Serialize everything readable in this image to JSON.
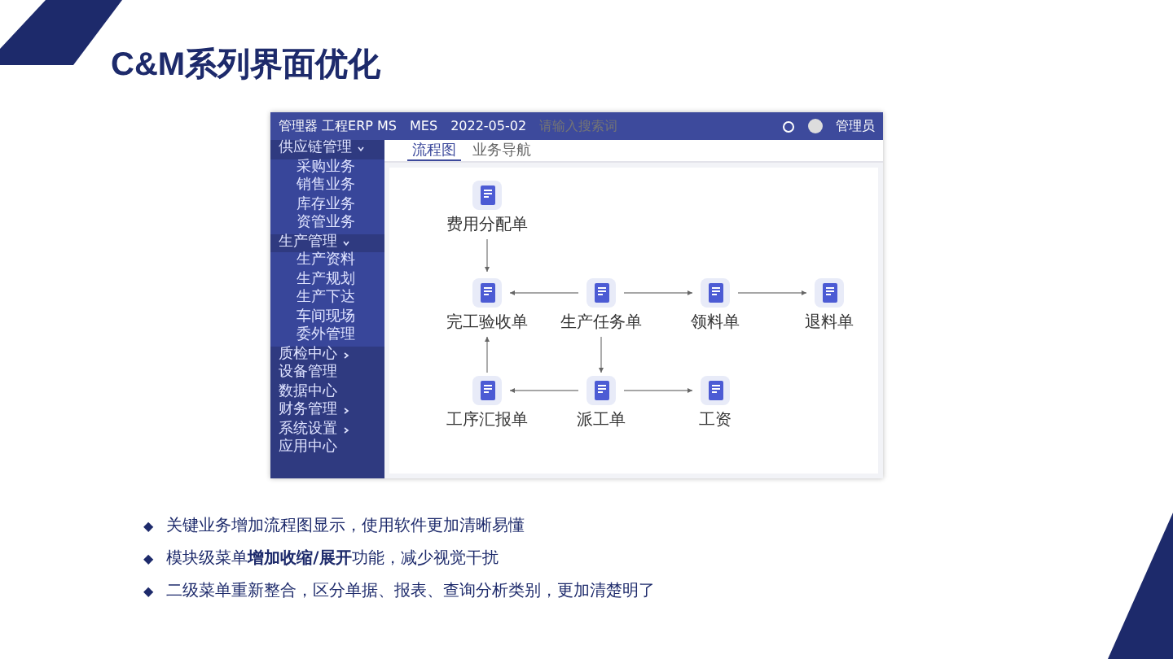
{
  "slide_title": "C&M系列界面优化",
  "app": {
    "brand": "管理器 工程ERP MS",
    "module": "MES",
    "date": "2022-05-02",
    "search": {
      "placeholder": "请输入搜索词"
    },
    "user": "管理员",
    "sidebar": [
      {
        "label": "供应链管理",
        "expanded": true,
        "children": [
          "采购业务",
          "销售业务",
          "库存业务",
          "资管业务"
        ]
      },
      {
        "label": "生产管理",
        "expanded": true,
        "children": [
          "生产资料",
          "生产规划",
          "生产下达",
          "车间现场",
          "委外管理"
        ]
      },
      {
        "label": "质检中心",
        "expanded": false
      },
      {
        "label": "设备管理"
      },
      {
        "label": "数据中心"
      },
      {
        "label": "财务管理",
        "expanded": false
      },
      {
        "label": "系统设置",
        "expanded": false
      },
      {
        "label": "应用中心"
      }
    ],
    "tabs": [
      {
        "label": "流程图",
        "selected": true
      },
      {
        "label": "业务导航",
        "selected": false
      }
    ],
    "flow": [
      "费用分配单",
      "完工验收单",
      "生产任务单",
      "领料单",
      "退料单",
      "工序汇报单",
      "派工单",
      "工资"
    ]
  },
  "bullets": [
    {
      "marker": "◆",
      "text": "关键业务增加流程图显示，使用软件更加清晰易懂"
    },
    {
      "marker": "◆",
      "text": "模块级菜单**增加收缩/展开**功能，减少视觉干扰"
    },
    {
      "marker": "◆",
      "text": "二级菜单重新整合，区分单据、报表、查询分析类别，更加清楚明了"
    }
  ]
}
